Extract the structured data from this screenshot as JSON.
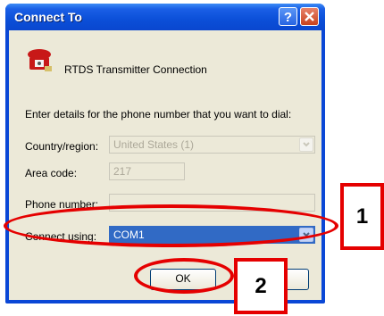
{
  "window": {
    "title": "Connect To",
    "help_label": "?",
    "close_label": "✕"
  },
  "header": {
    "connection_name": "RTDS Transmitter Connection",
    "icon": "telephone-icon"
  },
  "instructions": "Enter details for the phone number that you want to dial:",
  "form": {
    "country_label": "Country/region:",
    "country_value": "United States (1)",
    "area_code_label": "Area code:",
    "area_code_value": "217",
    "phone_label": "Phone number:",
    "phone_value": "",
    "connect_using_label": "Connect using:",
    "connect_using_value": "COM1"
  },
  "buttons": {
    "ok": "OK"
  },
  "annotations": {
    "callout_1": "1",
    "callout_2": "2",
    "highlight_color": "#e50000"
  }
}
